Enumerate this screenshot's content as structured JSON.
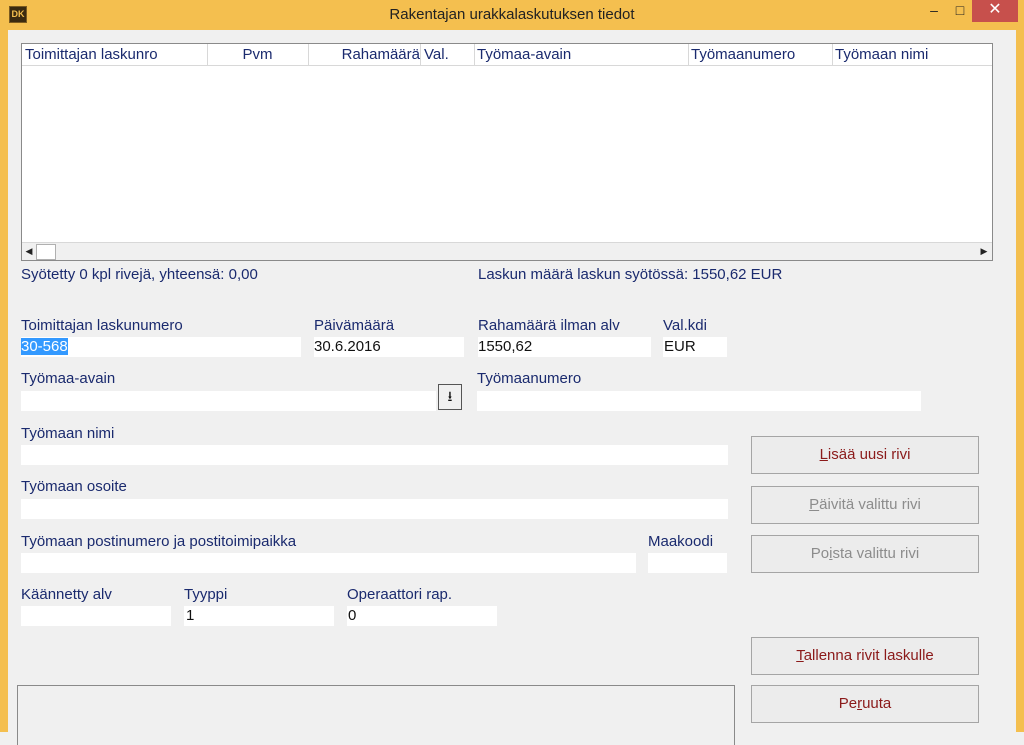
{
  "window": {
    "title": "Rakentajan urakkalaskutuksen tiedot",
    "icon_text": "DK",
    "minimize": "–",
    "maximize": "□",
    "close": "✕"
  },
  "grid": {
    "columns": [
      "Toimittajan laskunro",
      "Pvm",
      "Rahamäärä",
      "Val.",
      "Työmaa-avain",
      "Työmaanumero",
      "Työmaan nimi"
    ],
    "rows": [],
    "scroll_left": "◀",
    "scroll_right": "▶"
  },
  "summary": {
    "entered": "Syötetty 0 kpl rivejä, yhteensä:  0,00",
    "invoice_total": "Laskun määrä laskun syötössä:  1550,62 EUR"
  },
  "form": {
    "supplier_invoice_number": {
      "label": "Toimittajan laskunumero",
      "value": "30-568"
    },
    "date": {
      "label": "Päivämäärä",
      "value": "30.6.2016"
    },
    "amount_excl_vat": {
      "label": "Rahamäärä ilman alv",
      "value": "1550,62"
    },
    "currency": {
      "label": "Val.kdi",
      "value": "EUR"
    },
    "site_key": {
      "label": "Työmaa-avain",
      "value": ""
    },
    "site_number": {
      "label": "Työmaanumero",
      "value": ""
    },
    "site_name": {
      "label": "Työmaan nimi",
      "value": ""
    },
    "site_address": {
      "label": "Työmaan osoite",
      "value": ""
    },
    "site_postal": {
      "label": "Työmaan postinumero ja postitoimipaikka",
      "value": ""
    },
    "country_code": {
      "label": "Maakoodi",
      "value": ""
    },
    "reverse_vat": {
      "label": "Käännetty alv",
      "value": ""
    },
    "type": {
      "label": "Tyyppi",
      "value": "1"
    },
    "operator_report": {
      "label": "Operaattori rap.",
      "value": "0"
    }
  },
  "buttons": {
    "add_row": {
      "first": "L",
      "rest": "isää uusi rivi"
    },
    "update_row": {
      "first": "P",
      "rest": "äivitä valittu rivi"
    },
    "delete_row": {
      "first": "Po",
      "accel": "i",
      "rest": "sta valittu rivi"
    },
    "save_rows": {
      "first": "T",
      "rest": "allenna rivit laskulle"
    },
    "cancel": {
      "first": "Pe",
      "accel": "r",
      "rest": "uuta"
    },
    "dropdown_icon": "⭳"
  }
}
